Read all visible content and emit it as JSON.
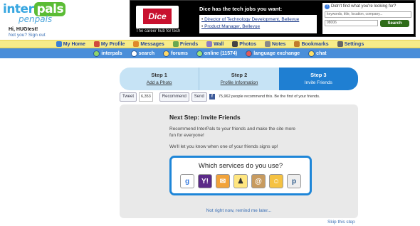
{
  "header": {
    "logo_left": "inter",
    "logo_right": "pals",
    "logo_sub": "penpals",
    "greeting": "Hi, HUGtest!",
    "not_you": "Not you? Sign out"
  },
  "ad": {
    "brand": "Dice",
    "tagline": "The career hub for tech",
    "headline": "Dice has the tech jobs you want:",
    "links": [
      "Director of Technology Development, Bellevue",
      "Product Manager, Bellevue"
    ],
    "question": "Didn't find what you're looking for?",
    "keyword_placeholder": "keywords, title, location, company...",
    "zip_value": "98006",
    "search_button": "Search"
  },
  "nav_main": [
    {
      "label": "My Home",
      "icon": "home-icon",
      "color": "#3b7fd6"
    },
    {
      "label": "My Profile",
      "icon": "profile-icon",
      "color": "#d14b3c"
    },
    {
      "label": "Messages",
      "icon": "envelope-icon",
      "color": "#e08a2a"
    },
    {
      "label": "Friends",
      "icon": "friends-icon",
      "color": "#6aa84f"
    },
    {
      "label": "Wall",
      "icon": "wall-icon",
      "color": "#8e7cc3"
    },
    {
      "label": "Photos",
      "icon": "camera-icon",
      "color": "#444444"
    },
    {
      "label": "Notes",
      "icon": "notes-icon",
      "color": "#888888"
    },
    {
      "label": "Bookmarks",
      "icon": "book-icon",
      "color": "#c27c2c"
    },
    {
      "label": "Settings",
      "icon": "tools-icon",
      "color": "#666666"
    }
  ],
  "nav_secondary": [
    {
      "label": "interpals",
      "icon": "interpals-icon",
      "color": "#8fd36a"
    },
    {
      "label": "search",
      "icon": "search-icon",
      "color": "#ffffff"
    },
    {
      "label": "forums",
      "icon": "forums-icon",
      "color": "#ffd866"
    },
    {
      "label": "online (11574)",
      "icon": "online-icon",
      "color": "#9be37a"
    },
    {
      "label": "language exchange",
      "icon": "flag-icon",
      "color": "#e05a5a"
    },
    {
      "label": "chat",
      "icon": "chat-icon",
      "color": "#ffe066"
    }
  ],
  "steps": [
    {
      "title": "Step 1",
      "sub": "Add a Photo"
    },
    {
      "title": "Step 2",
      "sub": "Profile Information"
    },
    {
      "title": "Step 3",
      "sub": "Invite Friends"
    }
  ],
  "social": {
    "tweet": "Tweet",
    "tweet_count": "6,353",
    "recommend": "Recommend",
    "send": "Send",
    "fb_text": "75,962 people recommend this. Be the first of your friends."
  },
  "next_step": {
    "title": "Next Step: Invite Friends",
    "p1": "Recommend InterPals to your friends and make the site more fun for everyone!",
    "p2": "We'll let you know when one of your friends signs up!",
    "services_title": "Which services do you use?",
    "services": [
      {
        "name": "google-icon",
        "glyph": "g",
        "bg": "#ffffff",
        "fg": "#3c7ee0"
      },
      {
        "name": "yahoo-icon",
        "glyph": "Y!",
        "bg": "#5b2a88",
        "fg": "#ffffff"
      },
      {
        "name": "hotmail-icon",
        "glyph": "✉",
        "bg": "#f2a33a",
        "fg": "#ffffff"
      },
      {
        "name": "aim-icon",
        "glyph": "♟",
        "bg": "#ffe680",
        "fg": "#333333"
      },
      {
        "name": "address-book-icon",
        "glyph": "@",
        "bg": "#c89b5f",
        "fg": "#ffffff"
      },
      {
        "name": "outlook-icon",
        "glyph": "☺",
        "bg": "#f5c242",
        "fg": "#ffffff"
      },
      {
        "name": "plaxo-icon",
        "glyph": "p",
        "bg": "#eeeeee",
        "fg": "#2e5b8a"
      }
    ],
    "not_now": "Not right now, remind me later...",
    "skip": "Skip this step"
  }
}
